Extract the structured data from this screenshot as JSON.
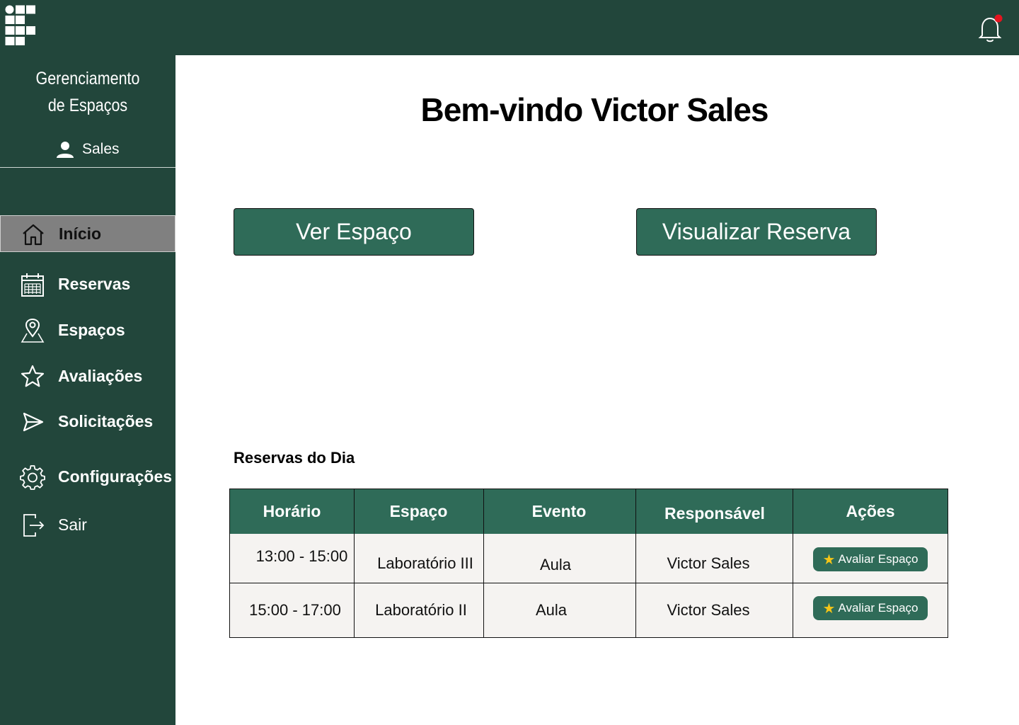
{
  "header": {
    "logo": "institution-logo",
    "notification_icon": "bell-icon",
    "notification_dot_color": "#e5141f"
  },
  "sidebar": {
    "title_line1": "Gerenciamento",
    "title_line2": "de Espaços",
    "user_name": "Sales",
    "items": [
      {
        "label": "Início",
        "icon": "home-icon",
        "active": true
      },
      {
        "label": "Reservas",
        "icon": "calendar-icon"
      },
      {
        "label": "Espaços",
        "icon": "map-pin-icon"
      },
      {
        "label": "Avaliações",
        "icon": "star-icon"
      },
      {
        "label": "Solicitações",
        "icon": "send-icon"
      },
      {
        "label": "Configurações",
        "icon": "gear-icon"
      },
      {
        "label": "Sair",
        "icon": "logout-icon"
      }
    ]
  },
  "main": {
    "welcome": "Bem-vindo Victor Sales",
    "buttons": {
      "ver_espaco": "Ver Espaço",
      "visualizar_reserva": "Visualizar Reserva"
    },
    "section_title": "Reservas do Dia",
    "table": {
      "headers": [
        "Horário",
        "Espaço",
        "Evento",
        "Responsável",
        "Ações"
      ],
      "rows": [
        {
          "horario": "13:00 - 15:00",
          "espaco": "Laboratório III",
          "evento": "Aula",
          "responsavel": "Victor Sales",
          "acao": "Avaliar Espaço"
        },
        {
          "horario": "15:00 - 17:00",
          "espaco": "Laboratório II",
          "evento": "Aula",
          "responsavel": "Victor Sales",
          "acao": "Avaliar Espaço"
        }
      ]
    }
  },
  "colors": {
    "dark_green": "#22463b",
    "button_green": "#2f6b58",
    "active_gray": "#808080",
    "row_bg": "#f5f3f1"
  }
}
